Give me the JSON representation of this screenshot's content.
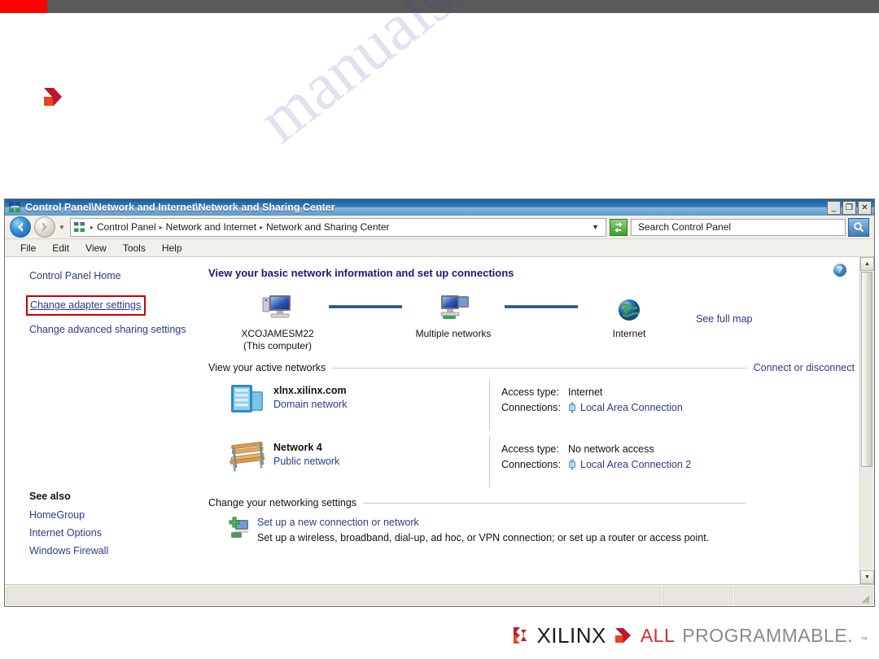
{
  "slide": {
    "accent_color": "#ff0000",
    "topbar_color": "#595959",
    "bullet_icon": "red-chevron-bullet"
  },
  "watermark": {
    "text": "manualslive.com"
  },
  "window": {
    "title": "Control Panel\\Network and Internet\\Network and Sharing Center",
    "title_icon": "network-sharing-center-icon",
    "controls": {
      "minimize": "_",
      "maximize": "❐",
      "close": "✕"
    }
  },
  "address_bar": {
    "back_icon": "back-arrow-icon",
    "forward_icon": "forward-arrow-icon",
    "history_caret": "▼",
    "path_icon": "control-panel-icon",
    "crumbs": [
      "Control Panel",
      "Network and Internet",
      "Network and Sharing Center"
    ],
    "crumb_sep": "▸",
    "dropdown_caret": "▼",
    "refresh_icon": "refresh-icon",
    "search": {
      "value": "Search Control Panel",
      "placeholder": "Search Control Panel",
      "icon": "search-magnifier-icon"
    }
  },
  "menu_bar": {
    "items": [
      "File",
      "Edit",
      "View",
      "Tools",
      "Help"
    ]
  },
  "left_pane": {
    "home_link": "Control Panel Home",
    "highlighted_link": "Change adapter settings",
    "advanced_link": "Change advanced sharing settings",
    "highlight_color": "#cc0000",
    "see_also": {
      "title": "See also",
      "links": [
        "HomeGroup",
        "Internet Options",
        "Windows Firewall"
      ]
    }
  },
  "content": {
    "help_icon": "help-question-icon",
    "heading": "View your basic network information and set up connections",
    "map": {
      "nodes": [
        {
          "icon": "computer-icon",
          "label_line1": "XCOJAMESM22",
          "label_line2": "(This computer)"
        },
        {
          "icon": "multiple-computers-icon",
          "label_line1": "Multiple networks",
          "label_line2": ""
        },
        {
          "icon": "globe-internet-icon",
          "label_line1": "Internet",
          "label_line2": ""
        }
      ],
      "see_full_map": "See full map"
    },
    "active_networks": {
      "section_title": "View your active networks",
      "tail_link": "Connect or disconnect",
      "rows": [
        {
          "icon": "domain-server-icon",
          "name": "xlnx.xilinx.com",
          "type": "Domain network",
          "access_label": "Access type:",
          "access_value": "Internet",
          "connections_label": "Connections:",
          "connection_icon": "network-adapter-icon",
          "connection_value": "Local Area Connection"
        },
        {
          "icon": "park-bench-public-icon",
          "name": "Network  4",
          "type": "Public network",
          "access_label": "Access type:",
          "access_value": "No network access",
          "connections_label": "Connections:",
          "connection_icon": "network-adapter-icon",
          "connection_value": "Local Area Connection 2"
        }
      ]
    },
    "networking_settings": {
      "section_title": "Change your networking settings",
      "setup_icon": "new-connection-icon",
      "setup_title": "Set up a new connection or network",
      "setup_desc": "Set up a wireless, broadband, dial-up, ad hoc, or VPN connection; or set up a router or access point."
    }
  },
  "scrollbar": {
    "up_arrow": "▲",
    "down_arrow": "▼"
  },
  "status_bar": {
    "pane1": "",
    "pane2": "",
    "pane3": "",
    "grip_icon": "resize-grip-icon"
  },
  "footer": {
    "mark_icon": "xilinx-x-mark",
    "brand": "XILINX",
    "chevron_icon": "xilinx-chevron-icon",
    "tagline_accent": "ALL",
    "tagline_rest": "PROGRAMMABLE.",
    "tagline_tm": "™",
    "accent_color": "#d8282f"
  }
}
